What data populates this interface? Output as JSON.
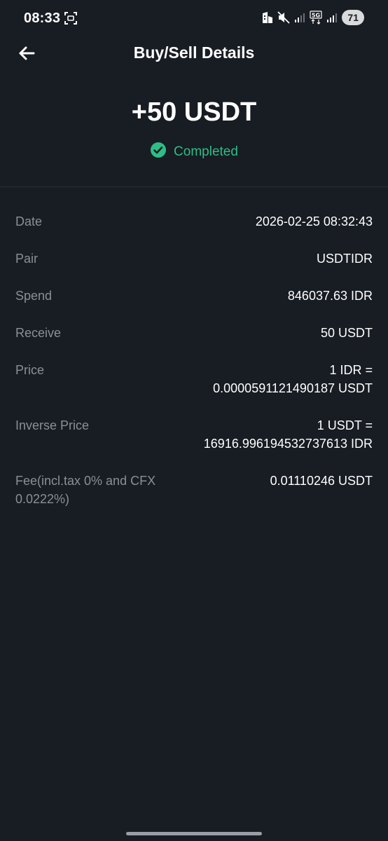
{
  "status_bar": {
    "time": "08:33",
    "battery": "71",
    "network": "5G"
  },
  "header": {
    "title": "Buy/Sell Details"
  },
  "summary": {
    "amount": "+50 USDT",
    "status": "Completed"
  },
  "details": [
    {
      "label": "Date",
      "value_line1": "2026-02-25 08:32:43",
      "value_line2": ""
    },
    {
      "label": "Pair",
      "value_line1": "USDTIDR",
      "value_line2": ""
    },
    {
      "label": "Spend",
      "value_line1": "846037.63 IDR",
      "value_line2": ""
    },
    {
      "label": "Receive",
      "value_line1": "50 USDT",
      "value_line2": ""
    },
    {
      "label": "Price",
      "value_line1": "1 IDR =",
      "value_line2": "0.0000591121490187 USDT"
    },
    {
      "label": "Inverse Price",
      "value_line1": "1 USDT =",
      "value_line2": "16916.996194532737613 IDR"
    },
    {
      "label": "Fee(incl.tax 0% and CFX 0.0222%)",
      "value_line1": "0.01110246 USDT",
      "value_line2": ""
    }
  ],
  "colors": {
    "background": "#181c23",
    "success": "#2ebd85",
    "label": "#8a8f98"
  }
}
